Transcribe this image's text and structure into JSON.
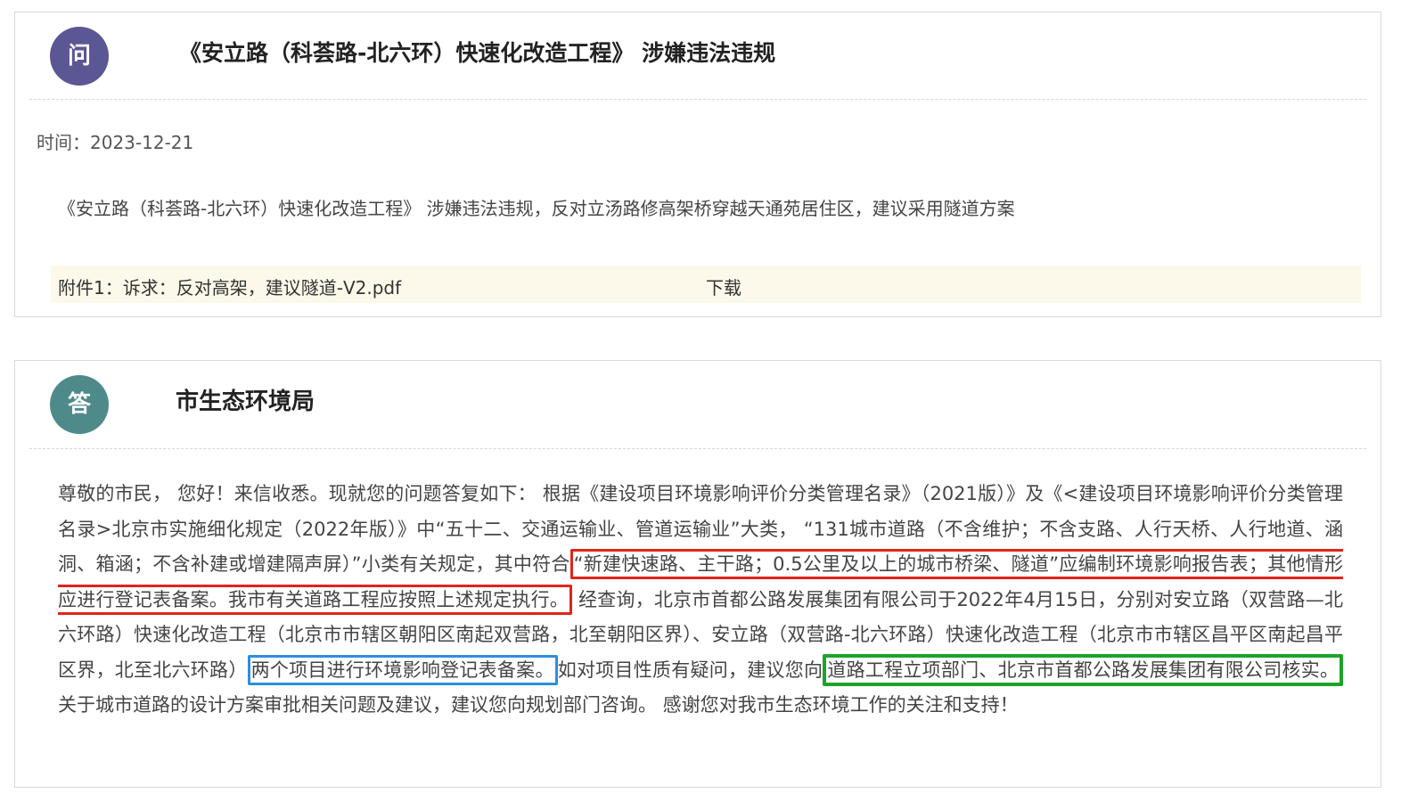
{
  "question": {
    "avatar_label": "问",
    "title": "《安立路（科荟路-北六环）快速化改造工程》 涉嫌违法违规",
    "time": "时间：2023-12-21",
    "content": "《安立路（科荟路-北六环）快速化改造工程》 涉嫌违法违规，反对立汤路修高架桥穿越天通苑居住区，建议采用隧道方案",
    "attachment": {
      "name": "附件1：诉求：反对高架，建议隧道-V2.pdf",
      "download_label": "下载"
    }
  },
  "answer": {
    "avatar_label": "答",
    "department": "市生态环境局",
    "segments": [
      "尊敬的市民， 您好！来信收悉。现就您的问题答复如下： 根据《建设项目环境影响评价分类管理名录》（2021版）》及《<建设项目环境影响评价分类管理名录>北京市实施细化规定（2022年版）》中“五十二、交通运输业、管道运输业”大类， “131城市道路（不含维护；不含支路、人行天桥、人行地道、涵洞、箱涵；不含补建或增建隔声屏）”小类有关规定，其中符合",
      "“新建快速路、主干路；0.5公里及以上的城市桥梁、隧道”应编制环境影响报告表；其他情形应进行登记表备案。我市有关道路工程应按照上述规定执行。",
      " 经查询，北京市首都公路发展集团有限公司于2022年4月15日，分别对安立路（双营路—北六环路）快速化改造工程（北京市市辖区朝阳区南起双营路，北至朝阳区界）、安立路（双营路-北六环路）快速化改造工程（北京市市辖区昌平区南起昌平区界，北至北六环路）",
      "两个项目进行环境影响登记表备案。",
      "如对项目性质有疑问，建议您向",
      "道路工程立项部门、北京市首都公路发展集团有限公司核实。",
      " 关于城市道路的设计方案审批相关问题及建议，建议您向规划部门咨询。 感谢您对我市生态环境工作的关注和支持！"
    ],
    "highlight_colors": {
      "red": "#e0241b",
      "blue": "#2d8ee0",
      "green": "#1ea32a"
    }
  }
}
